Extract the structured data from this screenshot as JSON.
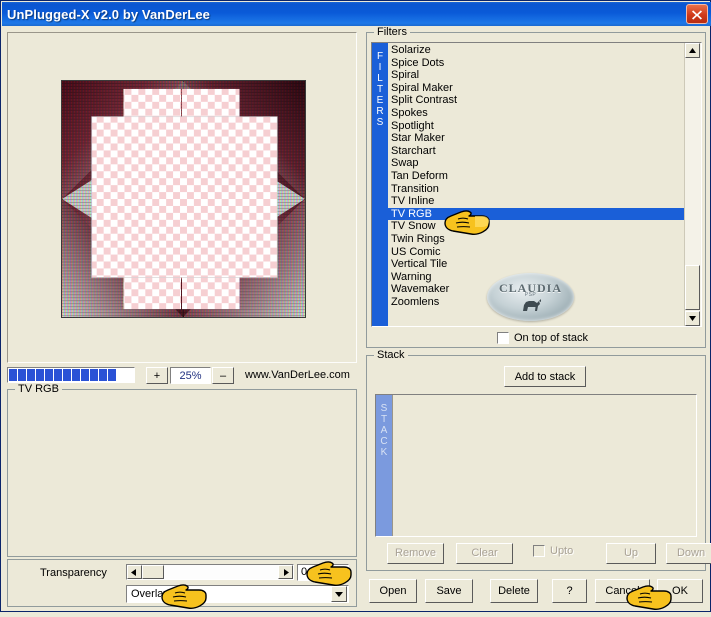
{
  "window": {
    "title": "UnPlugged-X v2.0 by VanDerLee",
    "close_label": "close-icon"
  },
  "preview": {
    "zoom_value": "25%",
    "zoom_in_label": "+",
    "zoom_out_label": "–",
    "website": "www.VanDerLee.com",
    "progress_blocks": 12
  },
  "filter_params": {
    "group_label": "TV RGB"
  },
  "transparency": {
    "group_label": "",
    "label": "Transparency",
    "value": "0",
    "blend_mode": "Overlay",
    "left_arrow": "◄",
    "right_arrow": "►",
    "dropdown_arrow": "▼"
  },
  "filters": {
    "group_label": "Filters",
    "sidebar_label": "FILTERS",
    "selected": "TV RGB",
    "items": [
      "Solarize",
      "Spice Dots",
      "Spiral",
      "Spiral Maker",
      "Split Contrast",
      "Spokes",
      "Spotlight",
      "Star Maker",
      "Starchart",
      "Swap",
      "Tan Deform",
      "Transition",
      "TV Inline",
      "TV RGB",
      "TV Snow",
      "Twin Rings",
      "US Comic",
      "Vertical Tile",
      "Warning",
      "Wavemaker",
      "Zoomlens"
    ],
    "scroll_up": "▲",
    "scroll_down": "▼",
    "on_top_of_stack": "On top of stack",
    "watermark_text": "CLAUDIA",
    "watermark_sub": "PSP",
    "watermark_figure": "ὀ8"
  },
  "stack": {
    "group_label": "Stack",
    "add_label": "Add to stack",
    "sidebar_label": "STACK",
    "items": [],
    "remove_label": "Remove",
    "clear_label": "Clear",
    "upto_label": "Upto",
    "up_label": "Up",
    "down_label": "Down"
  },
  "bottom": {
    "open": "Open",
    "save": "Save",
    "delete": "Delete",
    "help": "?",
    "cancel": "Cancel",
    "ok": "OK"
  },
  "colors": {
    "titlebar_blue": "#0a55d0",
    "selection_blue": "#1a5fd8",
    "face": "#ece9d8",
    "close_red": "#d03a1a",
    "progress_blue": "#2a52d6",
    "stack_sidebar_blue": "#7b9ade"
  }
}
